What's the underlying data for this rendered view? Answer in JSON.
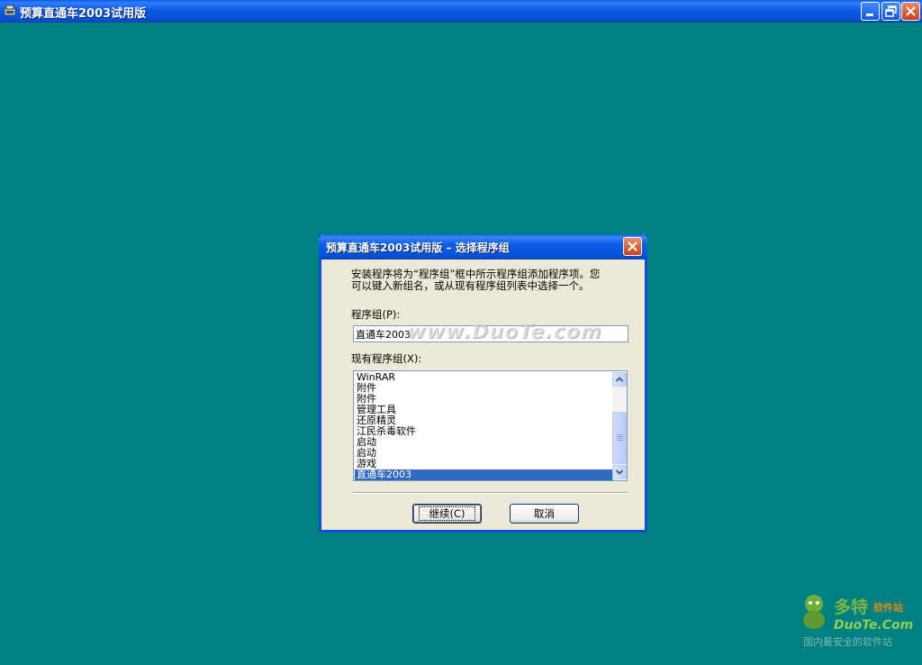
{
  "window": {
    "title": "预算直通车2003试用版",
    "controls": {
      "minimize_icon": "minimize-icon",
      "restore_icon": "restore-icon",
      "close_icon": "close-icon"
    }
  },
  "dialog": {
    "title": "预算直通车2003试用版 – 选择程序组",
    "intro_line1": "安装程序将为“程序组”框中所示程序组添加程序项。您",
    "intro_line2": "可以键入新组名，或从现有程序组列表中选择一个。",
    "group_label": "程序组(P):",
    "group_value": "直通车2003",
    "watermark": "www.DuoTe.com",
    "existing_label": "现有程序组(X):",
    "existing_groups": [
      "WinRAR",
      "附件",
      "附件",
      "管理工具",
      "还原精灵",
      "江民杀毒软件",
      "启动",
      "启动",
      "游戏",
      "直通车2003"
    ],
    "selected_group": "直通车2003",
    "continue_label": "继续(C)",
    "cancel_label": "取消"
  },
  "desktop_logo": {
    "name": "多特",
    "suffix": "软件站",
    "url": "DuoTe.Com",
    "tagline": "国内最安全的软件站"
  },
  "colors": {
    "desktop": "#008080",
    "titlebar": "#0a5ce8",
    "dialog_bg": "#ece9d8",
    "selection": "#316ac5"
  }
}
